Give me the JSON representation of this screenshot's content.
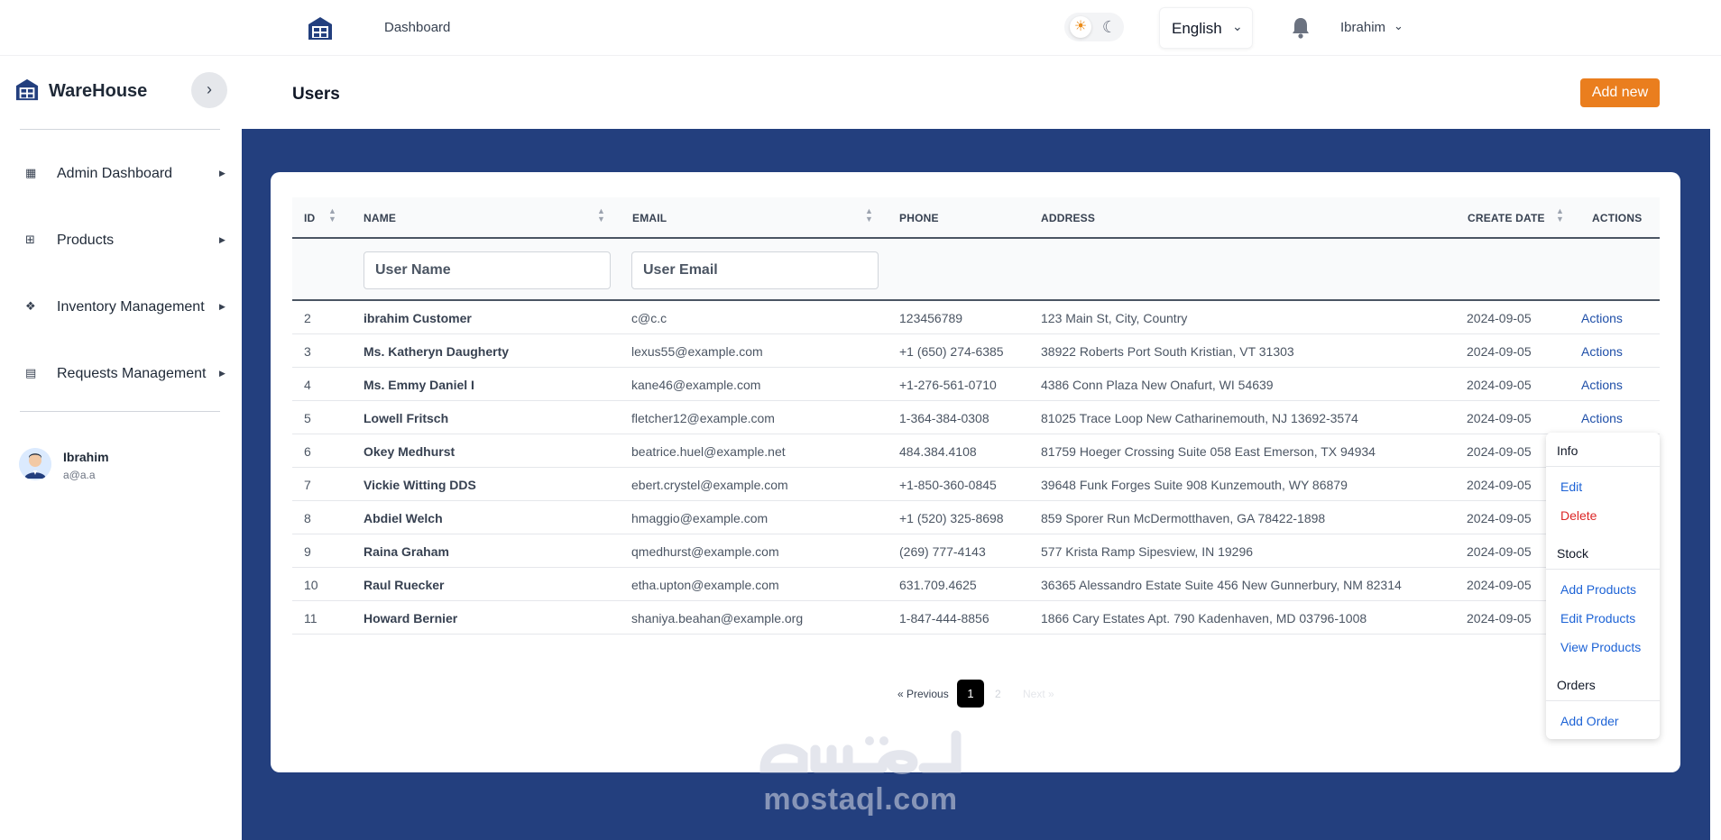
{
  "topbar": {
    "dashboard_link": "Dashboard",
    "language": "English",
    "user": "Ibrahim"
  },
  "sidebar": {
    "brand": "WareHouse",
    "items": [
      {
        "label": "Admin Dashboard",
        "icon": "grid-icon"
      },
      {
        "label": "Products",
        "icon": "apps-icon"
      },
      {
        "label": "Inventory Management",
        "icon": "dropbox-icon"
      },
      {
        "label": "Requests Management",
        "icon": "document-icon"
      }
    ],
    "user": {
      "name": "Ibrahim",
      "email": "a@a.a"
    }
  },
  "page": {
    "title": "Users",
    "add_new": "Add new"
  },
  "table": {
    "columns": [
      "ID",
      "NAME",
      "EMAIL",
      "PHONE",
      "ADDRESS",
      "CREATE DATE",
      "ACTIONS"
    ],
    "filters": {
      "name_placeholder": "User Name",
      "email_placeholder": "User Email"
    },
    "rows": [
      {
        "id": "2",
        "name": "ibrahim Customer",
        "email": "c@c.c",
        "phone": "123456789",
        "address": "123 Main St, City, Country",
        "date": "2024-09-05",
        "action": "Actions"
      },
      {
        "id": "3",
        "name": "Ms. Katheryn Daugherty",
        "email": "lexus55@example.com",
        "phone": "+1 (650) 274-6385",
        "address": "38922 Roberts Port South Kristian, VT 31303",
        "date": "2024-09-05",
        "action": "Actions"
      },
      {
        "id": "4",
        "name": "Ms. Emmy Daniel I",
        "email": "kane46@example.com",
        "phone": "+1-276-561-0710",
        "address": "4386 Conn Plaza New Onafurt, WI 54639",
        "date": "2024-09-05",
        "action": "Actions"
      },
      {
        "id": "5",
        "name": "Lowell Fritsch",
        "email": "fletcher12@example.com",
        "phone": "1-364-384-0308",
        "address": "81025 Trace Loop New Catharinemouth, NJ 13692-3574",
        "date": "2024-09-05",
        "action": "Actions"
      },
      {
        "id": "6",
        "name": "Okey Medhurst",
        "email": "beatrice.huel@example.net",
        "phone": "484.384.4108",
        "address": "81759 Hoeger Crossing Suite 058 East Emerson, TX 94934",
        "date": "2024-09-05",
        "action": ""
      },
      {
        "id": "7",
        "name": "Vickie Witting DDS",
        "email": "ebert.crystel@example.com",
        "phone": "+1-850-360-0845",
        "address": "39648 Funk Forges Suite 908 Kunzemouth, WY 86879",
        "date": "2024-09-05",
        "action": ""
      },
      {
        "id": "8",
        "name": "Abdiel Welch",
        "email": "hmaggio@example.com",
        "phone": "+1 (520) 325-8698",
        "address": "859 Sporer Run McDermotthaven, GA 78422-1898",
        "date": "2024-09-05",
        "action": ""
      },
      {
        "id": "9",
        "name": "Raina Graham",
        "email": "qmedhurst@example.com",
        "phone": "(269) 777-4143",
        "address": "577 Krista Ramp Sipesview, IN 19296",
        "date": "2024-09-05",
        "action": ""
      },
      {
        "id": "10",
        "name": "Raul Ruecker",
        "email": "etha.upton@example.com",
        "phone": "631.709.4625",
        "address": "36365 Alessandro Estate Suite 456 New Gunnerbury, NM 82314",
        "date": "2024-09-05",
        "action": ""
      },
      {
        "id": "11",
        "name": "Howard Bernier",
        "email": "shaniya.beahan@example.org",
        "phone": "1-847-444-8856",
        "address": "1866 Cary Estates Apt. 790 Kadenhaven, MD 03796-1008",
        "date": "2024-09-05",
        "action": ""
      }
    ]
  },
  "pagination": {
    "prev": "« Previous",
    "current": "1",
    "next_page": "2",
    "next": "Next »"
  },
  "dropdown": {
    "info": "Info",
    "edit": "Edit",
    "delete": "Delete",
    "stock": "Stock",
    "add_products": "Add Products",
    "edit_products": "Edit Products",
    "view_products": "View Products",
    "orders": "Orders",
    "add_order": "Add Order"
  },
  "watermark": {
    "latin": "mostaql.com"
  },
  "colors": {
    "accent": "#ea7e1e",
    "navy": "#233f7e",
    "link": "#1d63d6",
    "danger": "#dc2626"
  }
}
